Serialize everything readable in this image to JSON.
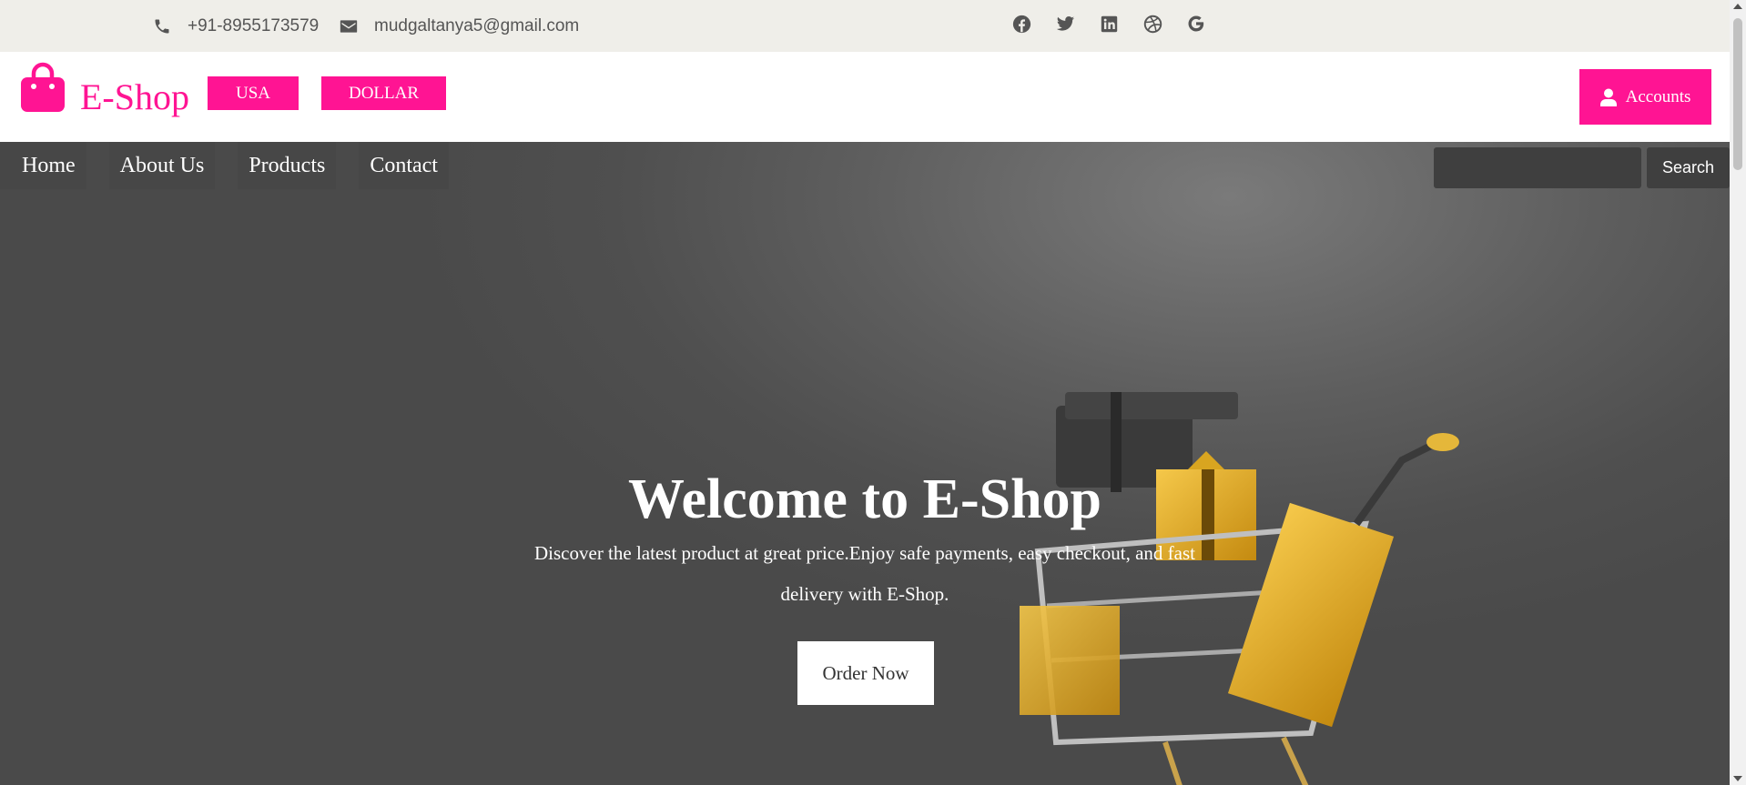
{
  "topbar": {
    "phone": "+91-8955173579",
    "email": "mudgaltanya5@gmail.com",
    "phone_icon": "phone-icon",
    "email_icon": "envelope-icon",
    "social_icons": [
      "facebook-icon",
      "twitter-icon",
      "linkedin-icon",
      "dribbble-icon",
      "google-icon"
    ]
  },
  "header": {
    "brand": "E-Shop",
    "brand_icon": "shopping-bag-icon",
    "region_label": "USA",
    "currency_label": "DOLLAR",
    "accounts_label": "Accounts",
    "accounts_icon": "user-icon"
  },
  "nav": {
    "items": [
      {
        "label": "Home"
      },
      {
        "label": "About Us"
      },
      {
        "label": "Products"
      },
      {
        "label": "Contact"
      }
    ],
    "search_placeholder": "",
    "search_button": "Search"
  },
  "hero": {
    "title": "Welcome to E-Shop",
    "subtitle": "Discover the latest product at great price.Enjoy safe payments, easy checkout, and fast delivery with E-Shop.",
    "cta": "Order Now"
  },
  "colors": {
    "accent": "#ff1493",
    "topbar_bg": "#efeee9",
    "hero_bg": "#505050"
  }
}
